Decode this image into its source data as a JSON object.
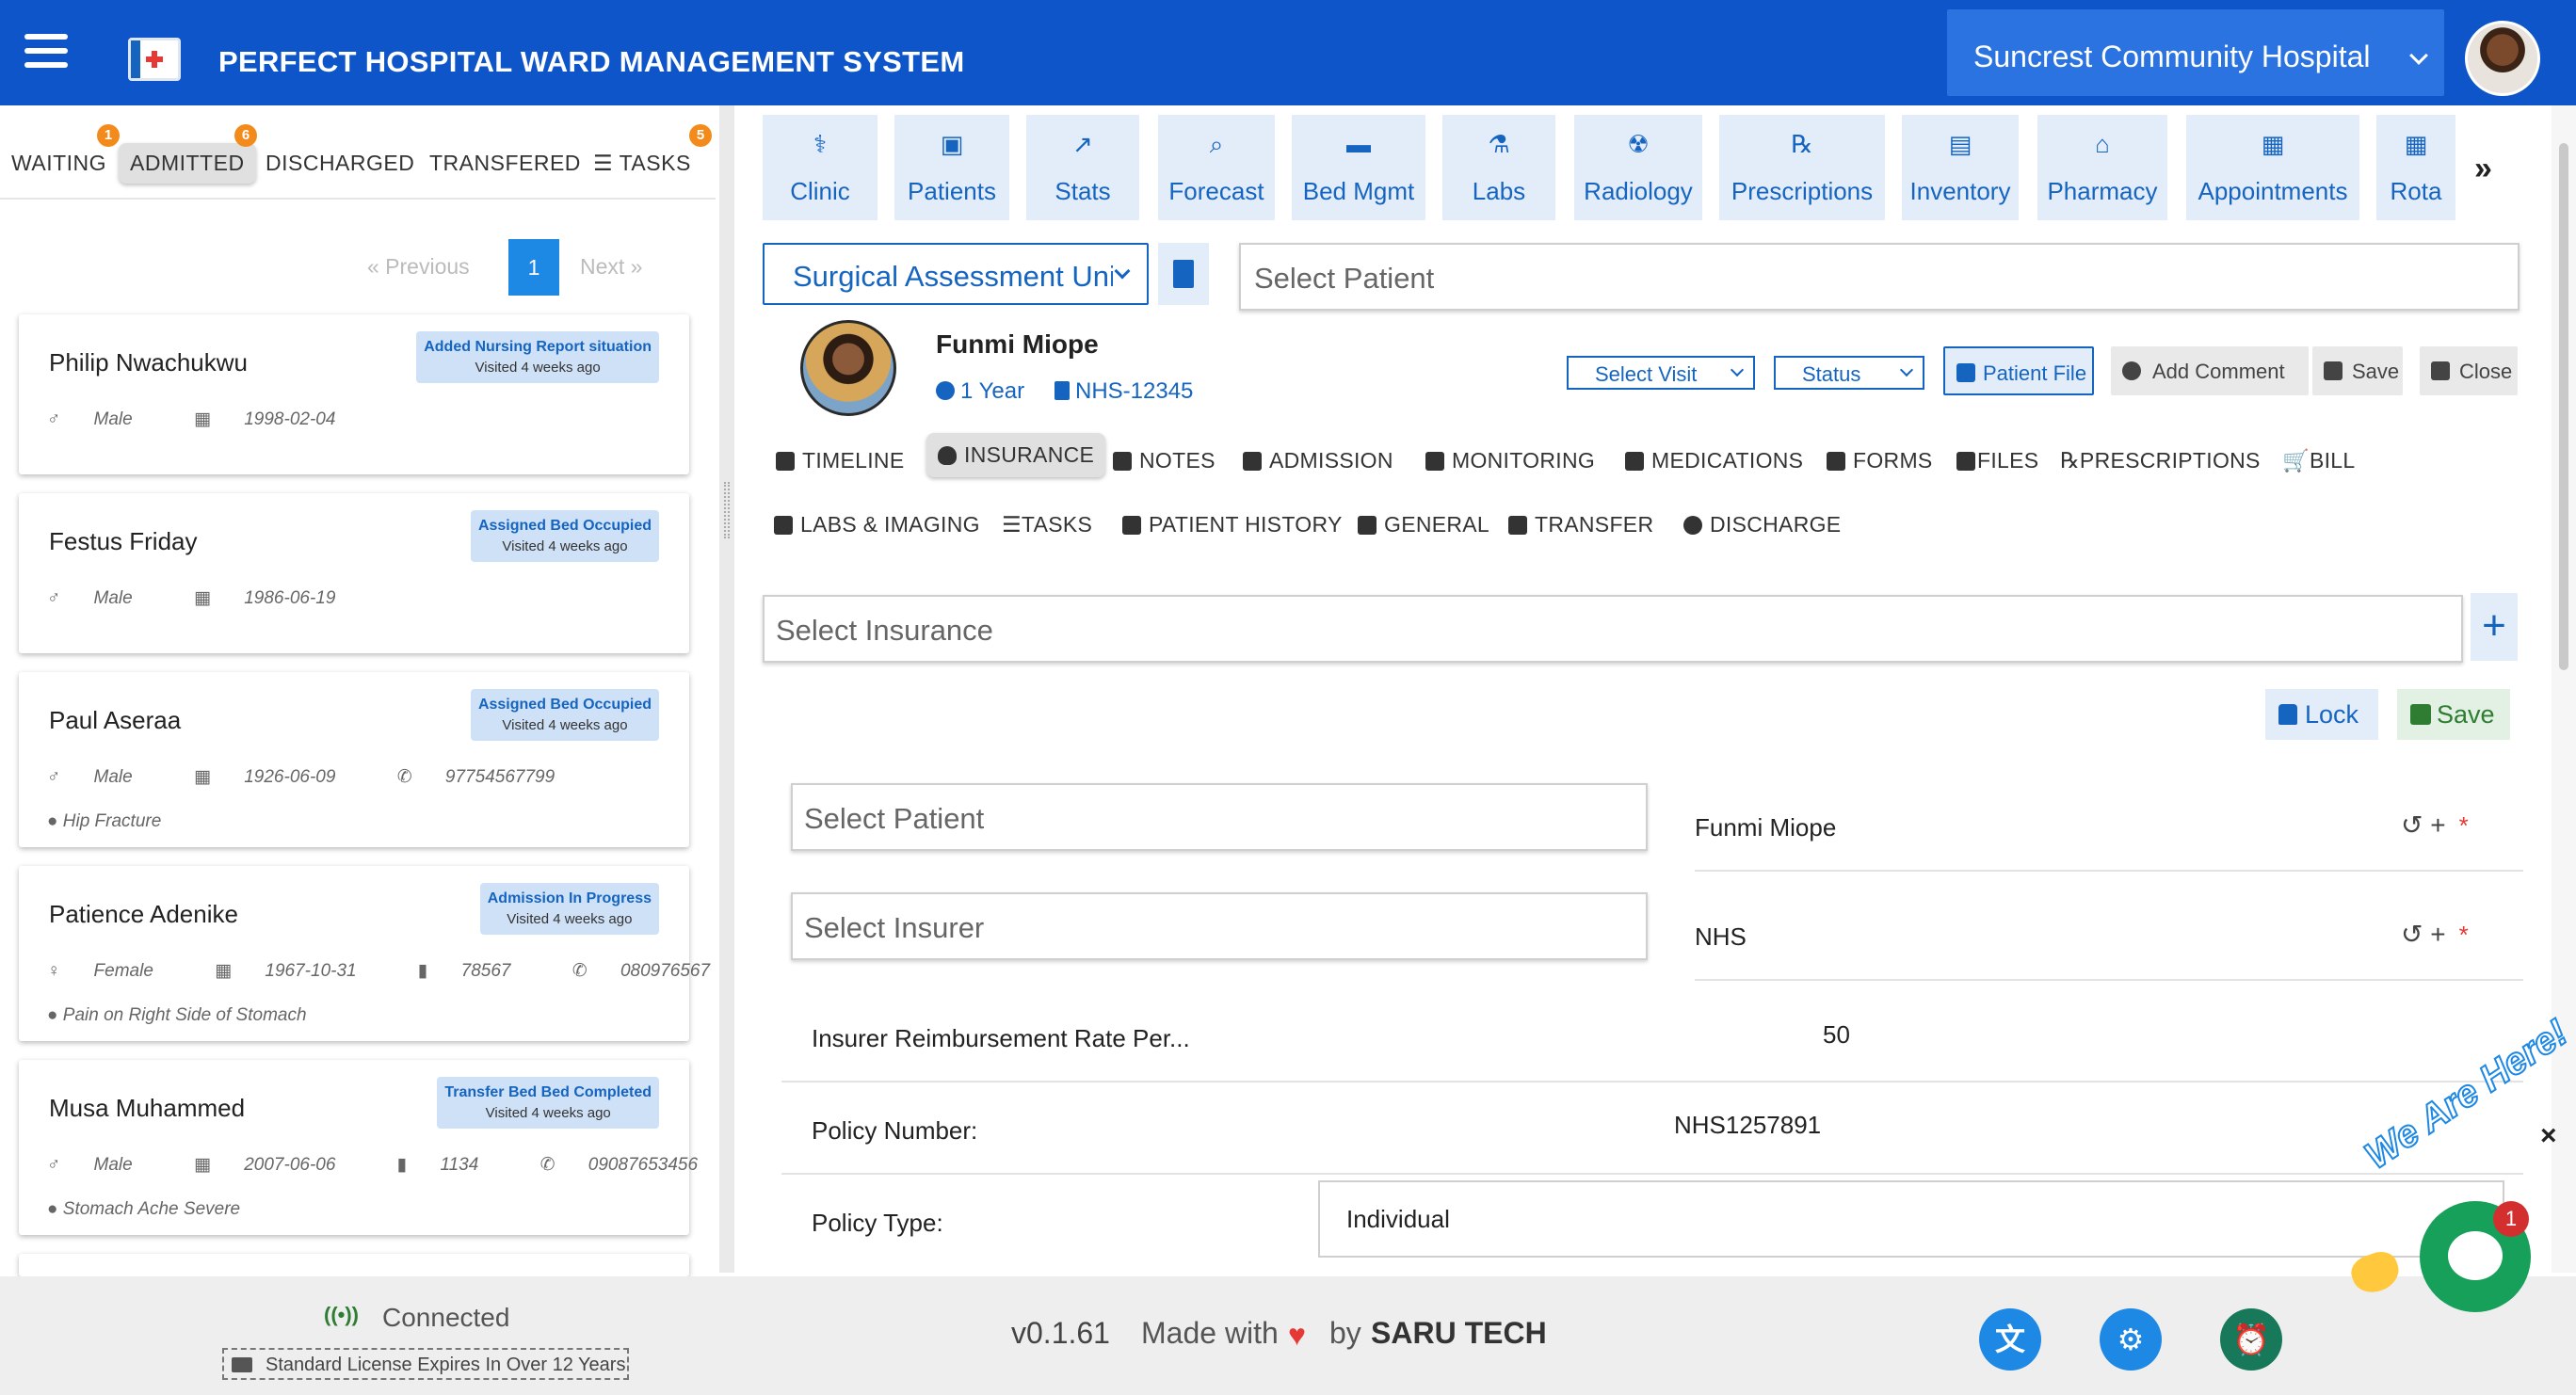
{
  "header": {
    "title": "PERFECT HOSPITAL WARD MANAGEMENT SYSTEM",
    "hospital": "Suncrest Community Hospital"
  },
  "left_tabs": [
    {
      "label": "WAITING",
      "badge": "1"
    },
    {
      "label": "ADMITTED",
      "badge": "6"
    },
    {
      "label": "DISCHARGED",
      "badge": ""
    },
    {
      "label": "TRANSFERED",
      "badge": ""
    },
    {
      "label": "TASKS",
      "badge": "5"
    }
  ],
  "pager": {
    "previous": "«  Previous",
    "page": "1",
    "next": "Next  »"
  },
  "patients": [
    {
      "name": "Philip Nwachukwu",
      "status": "Added Nursing Report situation",
      "visited": "Visited 4 weeks ago",
      "gender": "Male",
      "dob": "1998-02-04",
      "bed": "",
      "phone": "",
      "condition": ""
    },
    {
      "name": "Festus Friday",
      "status": "Assigned Bed Occupied",
      "visited": "Visited 4 weeks ago",
      "gender": "Male",
      "dob": "1986-06-19",
      "bed": "",
      "phone": "",
      "condition": ""
    },
    {
      "name": "Paul Aseraa",
      "status": "Assigned Bed Occupied",
      "visited": "Visited 4 weeks ago",
      "gender": "Male",
      "dob": "1926-06-09",
      "bed": "",
      "phone": "97754567799",
      "condition": "Hip Fracture"
    },
    {
      "name": "Patience Adenike",
      "status": "Admission In Progress",
      "visited": "Visited 4 weeks ago",
      "gender": "Female",
      "dob": "1967-10-31",
      "bed": "78567",
      "phone": "080976567",
      "condition": "Pain on Right Side of Stomach"
    },
    {
      "name": "Musa Muhammed",
      "status": "Transfer Bed Bed Completed",
      "visited": "Visited 4 weeks ago",
      "gender": "Male",
      "dob": "2007-06-06",
      "bed": "1134",
      "phone": "09087653456",
      "condition": "Stomach Ache Severe"
    }
  ],
  "modules": [
    {
      "label": "Clinic",
      "icon": "clinic-icon"
    },
    {
      "label": "Patients",
      "icon": "patients-icon"
    },
    {
      "label": "Stats",
      "icon": "stats-icon"
    },
    {
      "label": "Forecast",
      "icon": "forecast-icon"
    },
    {
      "label": "Bed Mgmt",
      "icon": "bed-icon"
    },
    {
      "label": "Labs",
      "icon": "flask-icon"
    },
    {
      "label": "Radiology",
      "icon": "radiology-icon"
    },
    {
      "label": "Prescriptions",
      "icon": "rx-icon"
    },
    {
      "label": "Inventory",
      "icon": "inventory-icon"
    },
    {
      "label": "Pharmacy",
      "icon": "pharmacy-icon"
    },
    {
      "label": "Appointments",
      "icon": "calendar-icon"
    },
    {
      "label": "Rota",
      "icon": "rota-icon"
    }
  ],
  "ward": {
    "selected": "Surgical Assessment Unit"
  },
  "patient_select": {
    "placeholder": "Select  Patient"
  },
  "patient": {
    "name": "Funmi Miope",
    "age": "1 Year",
    "nhs": "NHS-12345"
  },
  "actions": {
    "select_visit": "Select Visit",
    "status": "Status",
    "patient_file": "Patient File",
    "add_comment": "Add Comment",
    "save": "Save",
    "close": "Close"
  },
  "section_tabs_row1": [
    "TIMELINE",
    "INSURANCE",
    "NOTES",
    "ADMISSION",
    "MONITORING",
    "MEDICATIONS",
    "FORMS",
    "FILES",
    "PRESCRIPTIONS",
    "BILL"
  ],
  "section_tabs_row2": [
    "LABS & IMAGING",
    "TASKS",
    "PATIENT HISTORY",
    "GENERAL",
    "TRANSFER",
    "DISCHARGE"
  ],
  "insurance": {
    "select_placeholder": "Select  Insurance",
    "add": "+",
    "lock": "Lock",
    "save": "Save",
    "patient_placeholder": "Select  Patient",
    "patient_value": "Funmi Miope",
    "insurer_placeholder": "Select  Insurer",
    "insurer_value": "NHS",
    "rate_label": "Insurer Reimbursement Rate Per...",
    "rate_value": "50",
    "policy_number_label": "Policy Number:",
    "policy_number_value": "NHS1257891",
    "policy_type_label": "Policy Type:",
    "policy_type_value": "Individual"
  },
  "footer": {
    "connection": "Connected",
    "license": "Standard License Expires In Over 12 Years",
    "version": "v0.1.61",
    "made_with": "Made with",
    "by": "by",
    "brand": "SARU TECH"
  },
  "chat": {
    "badge": "1",
    "tagline": "We Are Here!"
  },
  "colors": {
    "primary": "#0d55c8",
    "accent": "#1565c0",
    "success": "#2e7d32",
    "danger": "#e53935",
    "badge": "#f28b1c"
  }
}
